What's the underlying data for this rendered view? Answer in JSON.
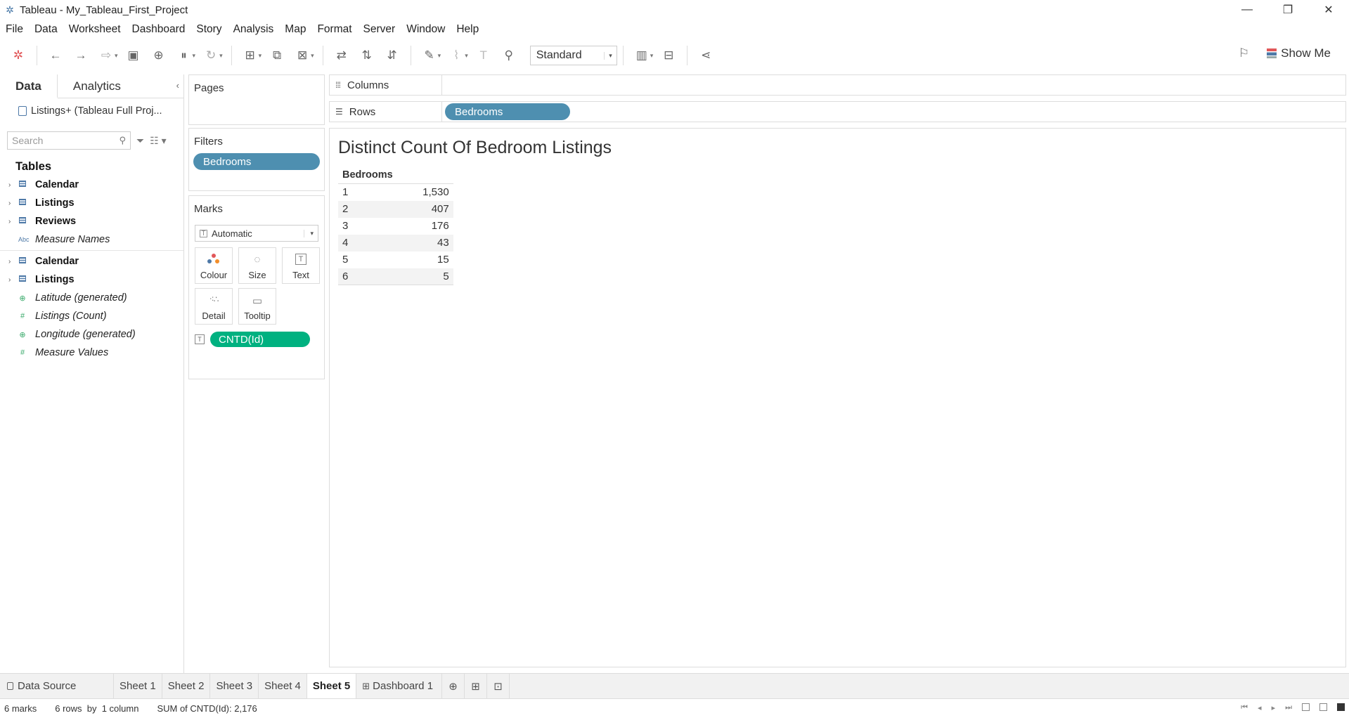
{
  "window": {
    "title": "Tableau - My_Tableau_First_Project",
    "controls": [
      "—",
      "❐",
      "✕"
    ]
  },
  "menu": [
    "File",
    "Data",
    "Worksheet",
    "Dashboard",
    "Story",
    "Analysis",
    "Map",
    "Format",
    "Server",
    "Window",
    "Help"
  ],
  "toolbar": {
    "fit": "Standard",
    "show_me": "Show Me"
  },
  "data_pane": {
    "tabs": [
      "Data",
      "Analytics"
    ],
    "datasource": "Listings+ (Tableau Full Proj...",
    "search_placeholder": "Search",
    "tables_heading": "Tables",
    "fields_a": [
      {
        "label": "Calendar",
        "kind": "table"
      },
      {
        "label": "Listings",
        "kind": "table"
      },
      {
        "label": "Reviews",
        "kind": "table"
      },
      {
        "label": "Measure Names",
        "kind": "abc"
      }
    ],
    "fields_b": [
      {
        "label": "Calendar",
        "kind": "table"
      },
      {
        "label": "Listings",
        "kind": "table"
      },
      {
        "label": "Latitude (generated)",
        "kind": "geo"
      },
      {
        "label": "Listings (Count)",
        "kind": "hash"
      },
      {
        "label": "Longitude (generated)",
        "kind": "geo"
      },
      {
        "label": "Measure Values",
        "kind": "hash"
      }
    ]
  },
  "cards": {
    "pages": "Pages",
    "filters": "Filters",
    "filter_pill": "Bedrooms",
    "marks": "Marks",
    "mark_type": "Automatic",
    "mark_buttons": [
      "Colour",
      "Size",
      "Text",
      "Detail",
      "Tooltip"
    ],
    "mark_field": "CNTD(Id)"
  },
  "shelves": {
    "columns_label": "Columns",
    "rows_label": "Rows",
    "rows_pill": "Bedrooms"
  },
  "sheet": {
    "title": "Distinct Count Of Bedroom Listings",
    "header": "Bedrooms",
    "rows": [
      {
        "dim": "1",
        "val": "1,530"
      },
      {
        "dim": "2",
        "val": "407"
      },
      {
        "dim": "3",
        "val": "176"
      },
      {
        "dim": "4",
        "val": "43"
      },
      {
        "dim": "5",
        "val": "15"
      },
      {
        "dim": "6",
        "val": "5"
      }
    ]
  },
  "tabs": {
    "data_source": "Data Source",
    "sheets": [
      "Sheet 1",
      "Sheet 2",
      "Sheet 3",
      "Sheet 4",
      "Sheet 5",
      "Dashboard 1"
    ],
    "active": "Sheet 5"
  },
  "status": {
    "marks": "6 marks",
    "rows": "6 rows  by  1 column",
    "sum": "SUM of CNTD(Id): 2,176"
  },
  "colors": {
    "dimension_pill": "#4e8fb0",
    "measure_pill": "#00b180",
    "accent": "#4e79a7"
  }
}
